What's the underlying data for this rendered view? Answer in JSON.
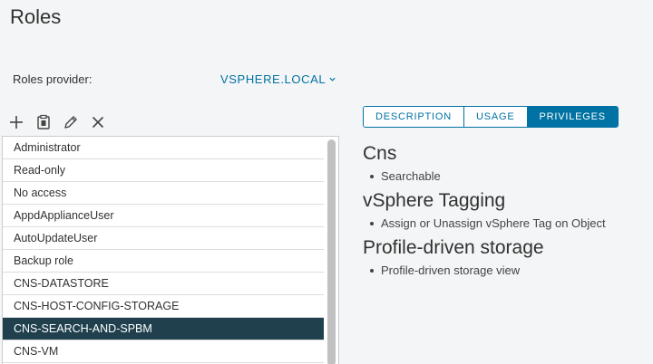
{
  "page": {
    "title": "Roles"
  },
  "provider": {
    "label": "Roles provider:",
    "value": "VSPHERE.LOCAL"
  },
  "toolbar": {
    "add_icon": "plus-icon",
    "clone_icon": "clipboard-icon",
    "edit_icon": "pencil-icon",
    "delete_icon": "close-icon"
  },
  "roles": [
    {
      "label": "Administrator"
    },
    {
      "label": "Read-only"
    },
    {
      "label": "No access"
    },
    {
      "label": "AppdApplianceUser"
    },
    {
      "label": "AutoUpdateUser"
    },
    {
      "label": "Backup role"
    },
    {
      "label": "CNS-DATASTORE"
    },
    {
      "label": "CNS-HOST-CONFIG-STORAGE"
    },
    {
      "label": "CNS-SEARCH-AND-SPBM",
      "selected": true
    },
    {
      "label": "CNS-VM"
    }
  ],
  "tabs": [
    {
      "label": "DESCRIPTION"
    },
    {
      "label": "USAGE"
    },
    {
      "label": "PRIVILEGES",
      "active": true
    }
  ],
  "privileges": [
    {
      "title": "Cns",
      "items": [
        "Searchable"
      ]
    },
    {
      "title": "vSphere Tagging",
      "items": [
        "Assign or Unassign vSphere Tag on Object"
      ]
    },
    {
      "title": "Profile-driven storage",
      "items": [
        "Profile-driven storage view"
      ]
    }
  ],
  "colors": {
    "accent": "#0072a3",
    "selected_row": "#20404e",
    "background": "#f4f5f6"
  }
}
